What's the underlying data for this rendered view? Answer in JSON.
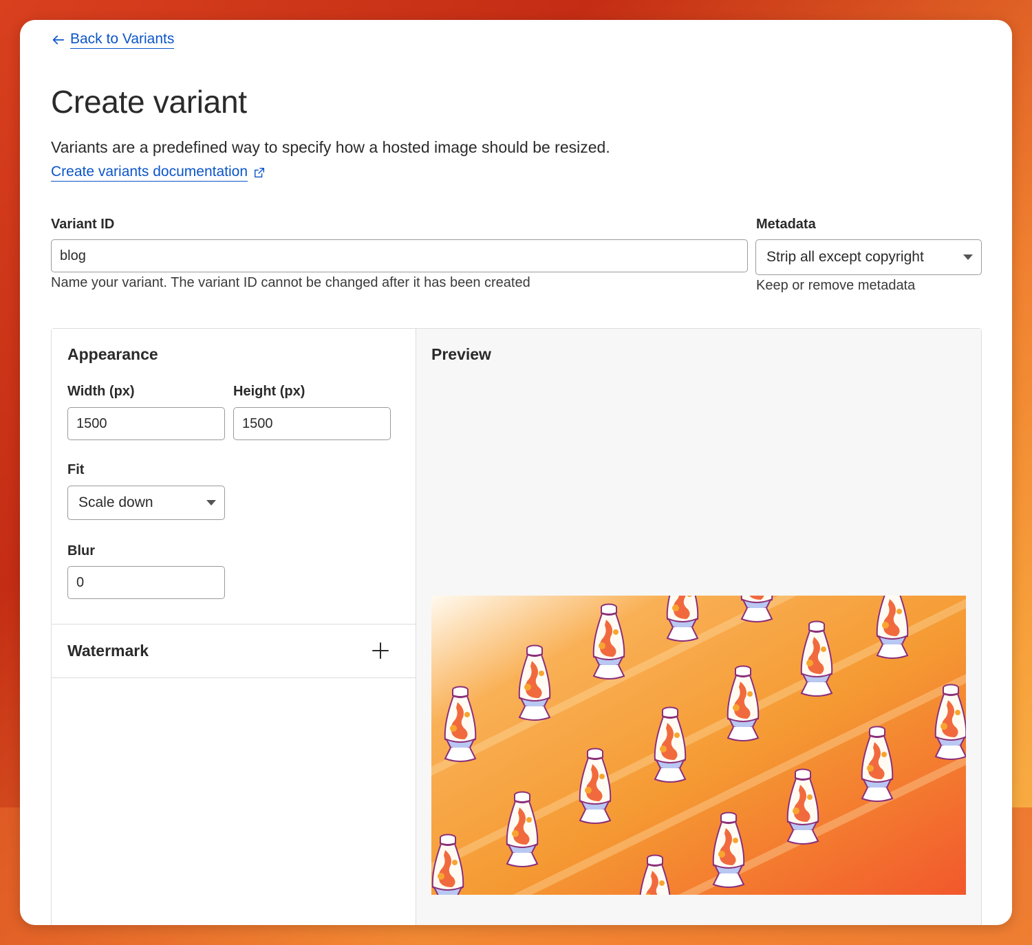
{
  "nav": {
    "back_label": "Back to Variants"
  },
  "page": {
    "title": "Create variant",
    "description": "Variants are a predefined way to specify how a hosted image should be resized.",
    "doc_link_label": "Create variants documentation"
  },
  "variant_id": {
    "label": "Variant ID",
    "value": "blog",
    "help": "Name your variant. The variant ID cannot be changed after it has been created"
  },
  "metadata": {
    "label": "Metadata",
    "selected": "Strip all except copyright",
    "help": "Keep or remove metadata"
  },
  "appearance": {
    "title": "Appearance",
    "width_label": "Width (px)",
    "width_value": "1500",
    "height_label": "Height (px)",
    "height_value": "1500",
    "fit_label": "Fit",
    "fit_selected": "Scale down",
    "blur_label": "Blur",
    "blur_value": "0"
  },
  "watermark": {
    "title": "Watermark"
  },
  "preview": {
    "title": "Preview"
  },
  "colors": {
    "link": "#0b55c9",
    "preview_orange": "#f59a33",
    "preview_red": "#f2582c",
    "lamp_red": "#f05a2a"
  },
  "icons": {
    "back": "arrow-left-icon",
    "external": "external-link-icon",
    "add": "plus-icon",
    "dropdown": "caret-down-icon"
  }
}
